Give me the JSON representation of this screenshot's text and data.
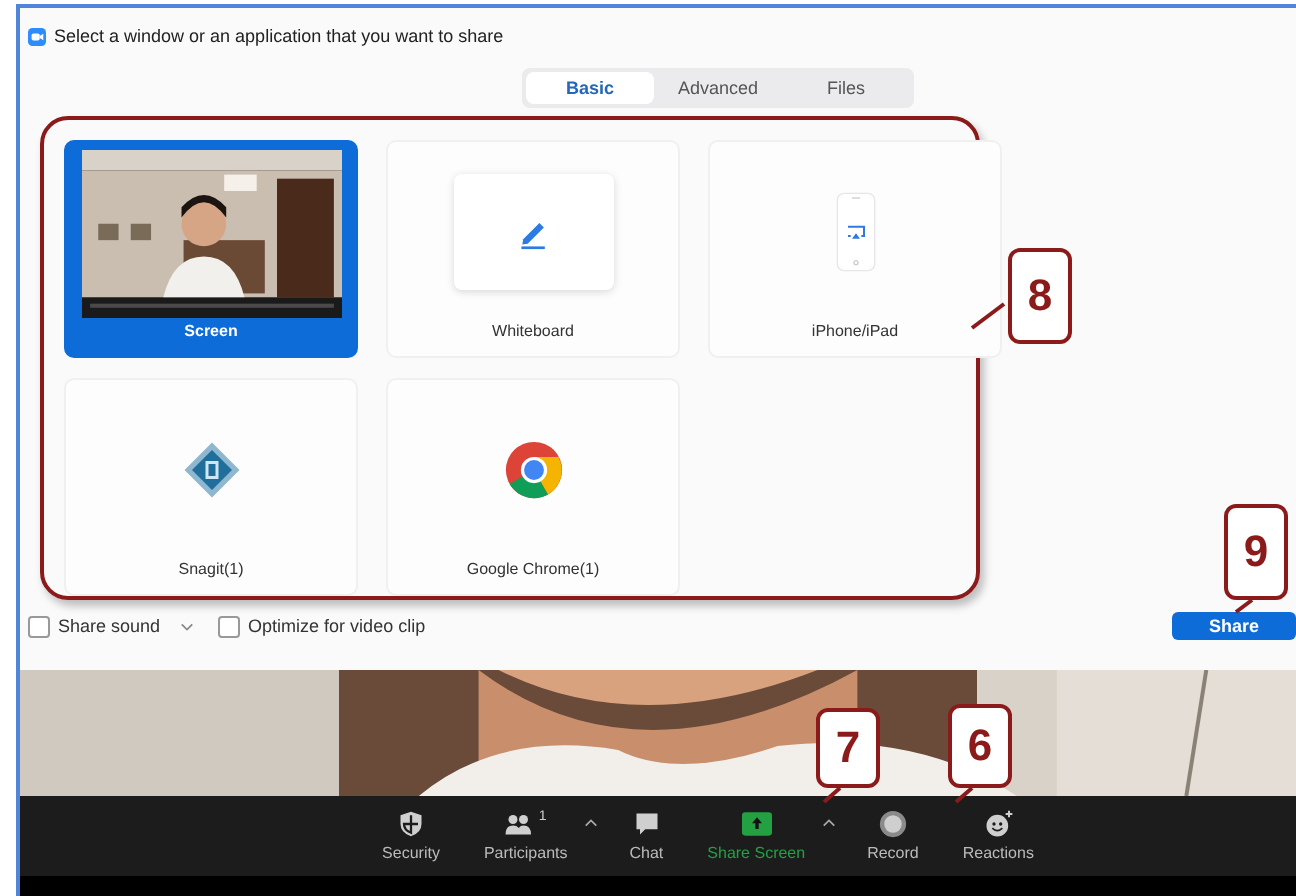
{
  "dialog": {
    "title": "Select a window or an application that you want to share",
    "tabs": [
      {
        "label": "Basic",
        "selected": true
      },
      {
        "label": "Advanced",
        "selected": false
      },
      {
        "label": "Files",
        "selected": false
      }
    ],
    "sources": [
      {
        "label": "Screen",
        "kind": "screen",
        "selected": true
      },
      {
        "label": "Whiteboard",
        "kind": "whiteboard",
        "selected": false
      },
      {
        "label": "iPhone/iPad",
        "kind": "iphone",
        "selected": false
      },
      {
        "label": "Snagit(1)",
        "kind": "snagit",
        "selected": false
      },
      {
        "label": "Google Chrome(1)",
        "kind": "chrome",
        "selected": false
      }
    ],
    "options": [
      {
        "label": "Share sound",
        "checked": false,
        "has_menu": true
      },
      {
        "label": "Optimize for video clip",
        "checked": false,
        "has_menu": false
      }
    ],
    "share_button": "Share"
  },
  "toolbar": {
    "items": [
      {
        "label": "Security",
        "kind": "security",
        "active": false,
        "has_menu": false
      },
      {
        "label": "Participants",
        "kind": "participants",
        "count": "1",
        "active": false,
        "has_menu": true
      },
      {
        "label": "Chat",
        "kind": "chat",
        "active": false,
        "has_menu": false
      },
      {
        "label": "Share Screen",
        "kind": "share",
        "active": true,
        "has_menu": true
      },
      {
        "label": "Record",
        "kind": "record",
        "active": false,
        "has_menu": false
      },
      {
        "label": "Reactions",
        "kind": "reactions",
        "active": false,
        "has_menu": false
      }
    ]
  },
  "callouts": [
    {
      "label": "8",
      "kind": "sources"
    },
    {
      "label": "9",
      "kind": "share"
    },
    {
      "label": "7",
      "kind": "share-screen"
    },
    {
      "label": "6",
      "kind": "record"
    }
  ]
}
